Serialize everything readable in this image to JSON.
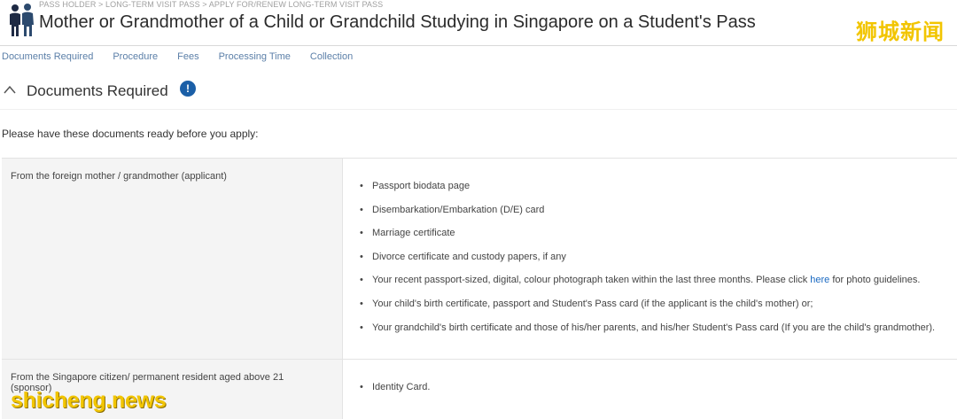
{
  "header": {
    "breadcrumb": "PASS HOLDER > LONG-TERM VISIT PASS > APPLY FOR/RENEW LONG-TERM VISIT PASS",
    "title": "Mother or Grandmother of a Child or Grandchild Studying in Singapore on a Student's Pass",
    "logo_icon": "people-icon"
  },
  "watermarks": {
    "top_right": "狮城新闻",
    "bottom_left": "shicheng.news"
  },
  "tabs": [
    "Documents Required",
    "Procedure",
    "Fees",
    "Processing Time",
    "Collection"
  ],
  "section": {
    "title": "Documents Required",
    "info_badge": "!",
    "intro": "Please have these documents ready before you apply:"
  },
  "table": {
    "rows": [
      {
        "label": "From the foreign mother / grandmother (applicant)",
        "items": [
          "Passport biodata page",
          "Disembarkation/Embarkation (D/E) card",
          "Marriage certificate",
          "Divorce certificate and custody papers, if any",
          "Your child's birth certificate, passport and Student's Pass card (if the applicant is the child's mother) or;",
          "Your grandchild's birth certificate and those of his/her parents, and his/her Student's Pass card (If you are the child's grandmother)."
        ],
        "photo_item": {
          "before": "Your recent passport-sized, digital, colour photograph taken within the last three months. Please click ",
          "link": "here",
          "after": " for photo guidelines."
        }
      },
      {
        "label": "From the Singapore citizen/ permanent resident aged above 21 (sponsor)",
        "items": [
          "Identity Card."
        ]
      }
    ]
  },
  "colors": {
    "accent": "#1b5fa7",
    "tab_link": "#5b7fa8",
    "watermark": "#f2c500"
  }
}
